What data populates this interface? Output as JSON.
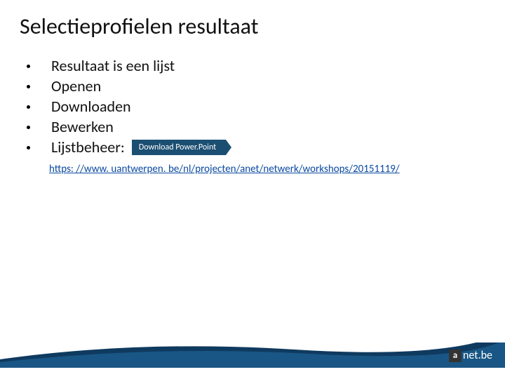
{
  "title": "Selectieprofielen resultaat",
  "bullets": [
    "Resultaat is een lijst",
    "Openen",
    "Downloaden",
    "Bewerken",
    "Lijstbeheer:"
  ],
  "download_button_label": "Download Power.Point",
  "link": {
    "text": "https: //www. uantwerpen. be/nl/projecten/anet/netwerk/workshops/20151119/"
  },
  "logo": {
    "box": "a",
    "text": "net.be"
  }
}
